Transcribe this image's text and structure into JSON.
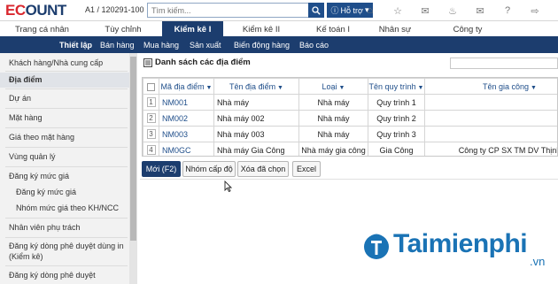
{
  "app": {
    "logo_left": "EC",
    "logo_right": "OUNT",
    "account": "A1 / 120291-100",
    "search": {
      "placeholder": "Tìm kiếm..."
    },
    "help_label": "Hỗ trợ",
    "top_icons": [
      "home-icon",
      "star-icon",
      "chat-icon",
      "bell-icon",
      "mail-icon",
      "help-icon",
      "logout-icon"
    ]
  },
  "main_nav": [
    "Trang cá nhân",
    "Tùy chỉnh",
    "Kiểm kê I",
    "Kiểm kê II",
    "Kế toán I",
    "Nhân sự",
    "Công ty"
  ],
  "main_nav_active": 2,
  "sub_nav": [
    "Thiết lập",
    "Bán hàng",
    "Mua hàng",
    "Sản xuất",
    "Biến động hàng",
    "Báo cáo"
  ],
  "sidebar": {
    "items": [
      "Khách hàng/Nhà cung cấp",
      "Địa điểm",
      "Dự án",
      "Mặt hàng",
      "Giá theo mặt hàng",
      "Vùng quản lý",
      "Đăng ký mức giá",
      "Đăng ký mức giá",
      "Nhóm mức giá theo KH/NCC",
      "Nhân viên phụ trách",
      "Đăng ký dòng phê duyệt dùng in",
      "(Kiểm kê)",
      "Đăng ký dòng phê duyệt"
    ]
  },
  "content": {
    "title": "Danh sách các địa điểm",
    "columns": [
      "Mã địa điểm",
      "Tên địa điểm",
      "Loại",
      "Tên quy trình",
      "Tên gia công"
    ],
    "rows": [
      {
        "no": "1",
        "code": "NM001",
        "name": "Nhà máy",
        "type": "Nhà máy",
        "process": "Quy trình 1",
        "outsource": ""
      },
      {
        "no": "2",
        "code": "NM002",
        "name": "Nhà máy 002",
        "type": "Nhà máy",
        "process": "Quy trình 2",
        "outsource": ""
      },
      {
        "no": "3",
        "code": "NM003",
        "name": "Nhà máy 003",
        "type": "Nhà máy",
        "process": "Quy trình 3",
        "outsource": ""
      },
      {
        "no": "4",
        "code": "NM0GC",
        "name": "Nhà máy Gia Công",
        "type": "Nhà máy gia công",
        "process": "Gia Công",
        "outsource": "Công ty CP SX TM DV Thịnh"
      }
    ],
    "buttons": [
      "Mới (F2)",
      "Nhóm cấp độ",
      "Xóa đã chọn",
      "Excel"
    ]
  },
  "watermark": {
    "brand": "Taimienphi",
    "suffix": ".vn"
  },
  "colors": {
    "navy": "#1c3d6e",
    "brand_red": "#d9272e",
    "link_blue": "#1f4e8a",
    "watermark": "#1a73b5"
  }
}
